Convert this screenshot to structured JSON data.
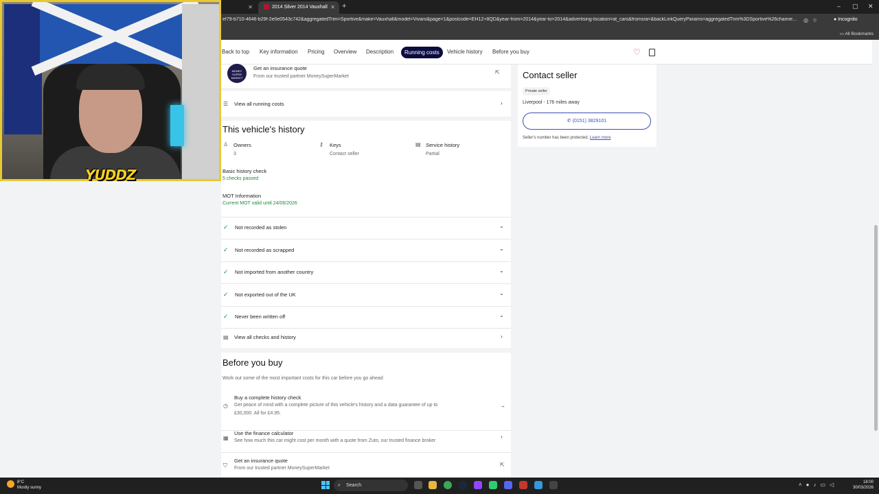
{
  "browser": {
    "tabs": [
      {
        "label": "",
        "active": false
      },
      {
        "label": "2014 Silver 2014 Vauxhall Vivaro",
        "active": true
      }
    ],
    "url": "ef79-b710-4646-b29f-2e0e0543c742&aggregatedTrim=Sportive&make=Vauxhall&model=Vivaro&page=1&postcode=EH12+8QD&year-from=2014&year-to=2014&advertising-location=at_cars&fromsra=&backLinkQueryParams=aggregatedTrim%3DSportive%26channe...",
    "incognito_label": "Incognito",
    "all_bookmarks": "All Bookmarks"
  },
  "subnav": {
    "items": [
      "Back to top",
      "Key information",
      "Pricing",
      "Overview",
      "Description",
      "Running costs",
      "Vehicle history",
      "Before you buy"
    ],
    "active": "Running costs"
  },
  "insurance_top": {
    "logo_text": "MONEY SUPER MARKET",
    "title": "Get an insurance quote",
    "subtitle": "From our trusted partner MoneySuperMarket"
  },
  "view_running_costs": "View all running costs",
  "history": {
    "title": "This vehicle's history",
    "owners_label": "Owners",
    "owners_value": "3",
    "keys_label": "Keys",
    "keys_value": "Contact seller",
    "service_label": "Service history",
    "service_value": "Partial",
    "basic_check_label": "Basic history check",
    "basic_check_value": "5 checks passed",
    "mot_label": "MOT Information",
    "mot_value": "Current MOT valid until 24/06/2026",
    "checks": [
      "Not recorded as stolen",
      "Not recorded as scrapped",
      "Not imported from another country",
      "Not exported out of the UK",
      "Never been written off"
    ],
    "view_all": "View all checks and history"
  },
  "before_you_buy": {
    "title": "Before you buy",
    "subtitle": "Work out some of the most important costs for this car before you go ahead",
    "items": [
      {
        "title": "Buy a complete history check",
        "desc1": "Get peace of mind with a complete picture of this vehicle's history and a data guarantee of up to",
        "desc2": "£30,000. All for £4.95."
      },
      {
        "title": "Use the finance calculator",
        "desc1": "See how much this car might cost per month with a quote from Zuto, our trusted finance broker",
        "desc2": ""
      },
      {
        "title": "Get an insurance quote",
        "desc1": "From our trusted partner MoneySuperMarket",
        "desc2": ""
      }
    ]
  },
  "seller": {
    "title": "Contact seller",
    "badge": "Private seller",
    "location": "Liverpool - 176 miles away",
    "phone": "(0151) 3829101",
    "protected": "Seller's number has been protected.",
    "learn_more": "Learn more"
  },
  "webcam": {
    "logo": "YUDDZ"
  },
  "taskbar": {
    "weather_temp": "8°C",
    "weather_desc": "Mostly sunny",
    "search": "Search",
    "time": "18:00",
    "date": "30/03/2026"
  },
  "colors": {
    "accent_navy": "#0b0c3f",
    "check_green": "#1e8a3c",
    "link_blue": "#3b4fb5",
    "heart_red": "#d6282f",
    "webcam_border": "#e9c931"
  }
}
